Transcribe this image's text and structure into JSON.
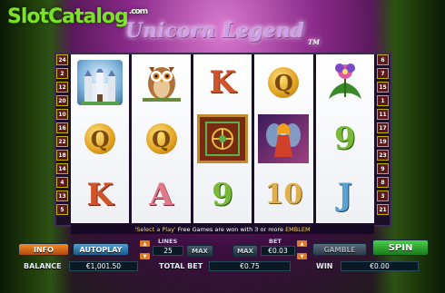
{
  "watermark": {
    "brand": "SlotCatalog",
    "suffix": ".com"
  },
  "game": {
    "title": "Unicorn Legend",
    "tm": "TM"
  },
  "paylines": {
    "left": [
      "24",
      "2",
      "12",
      "20",
      "10",
      "16",
      "22",
      "18",
      "14",
      "4",
      "13",
      "5"
    ],
    "right": [
      "6",
      "7",
      "15",
      "1",
      "11",
      "17",
      "19",
      "23",
      "9",
      "8",
      "3",
      "21"
    ]
  },
  "reels": [
    [
      "castle",
      "Q",
      "K"
    ],
    [
      "owl",
      "Q",
      "A"
    ],
    [
      "K",
      "emblem",
      "9"
    ],
    [
      "Q",
      "fairy",
      "10"
    ],
    [
      "flower",
      "9",
      "J"
    ]
  ],
  "info_line": {
    "part1": "'Select a Play'",
    "part2": "Free Games are won with 3 or more",
    "part3": "EMBLEM"
  },
  "controls": {
    "info": "INFO",
    "autoplay": "AUTOPLAY",
    "lines_label": "LINES",
    "lines_value": "25",
    "lines_max": "MAX",
    "bet_label": "BET",
    "bet_max": "MAX",
    "bet_value": "€0.03",
    "gamble": "GAMBLE",
    "spin": "SPIN",
    "balance_label": "BALANCE",
    "balance_value": "€1,001.50",
    "total_bet_label": "TOTAL BET",
    "total_bet_value": "€0.75",
    "win_label": "WIN",
    "win_value": "€0.00"
  }
}
